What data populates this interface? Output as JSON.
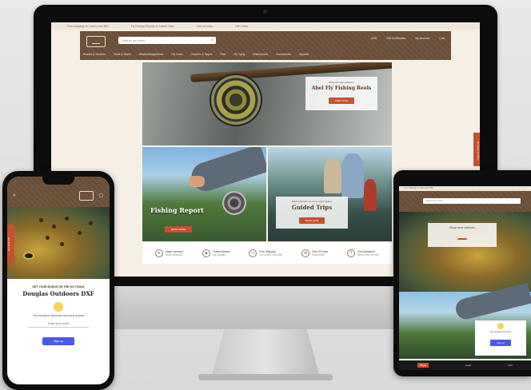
{
  "desktop": {
    "topbar": [
      "Free shipping on orders over $50",
      "Fly Fishing Reports & Guided Trips",
      "Call us today",
      "Gift Cards"
    ],
    "search_placeholder": "Search our store",
    "header_right": [
      "USD",
      "Gift Certificates",
      "My Account",
      "Cart"
    ],
    "nav": [
      "Brands & Vendors",
      "Rods & Reels",
      "Waders/Bags/Boots",
      "Fly Lines",
      "Leaders & Tippet",
      "Flies",
      "Fly Tying",
      "Waterproofs",
      "Accessories",
      "Apparel"
    ],
    "hero": {
      "subtitle": "Shop our new collection",
      "title": "Abel Fly Fishing Reels",
      "button": "SHOP NOW"
    },
    "tile_left": {
      "title": "Fishing Report",
      "button": "READ MORE"
    },
    "tile_right": {
      "subtitle": "Book a trip with one of our expert guides",
      "title": "Guided Trips",
      "button": "BOOK NOW"
    },
    "features": [
      {
        "icon": "map-icon",
        "title": "Large Inventory",
        "text": "Shop Selection"
      },
      {
        "icon": "tag-icon",
        "title": "Trusted Brands",
        "text": "Top Quality"
      },
      {
        "icon": "truck-icon",
        "title": "Free Shipping",
        "text": "On Orders Over $50"
      },
      {
        "icon": "chat-icon",
        "title": "Over 25 Years",
        "text": "Experience"
      },
      {
        "icon": "question-icon",
        "title": "Got Questions?",
        "text": "We're Here to Help"
      }
    ],
    "side_tab": "Rewards & Offers"
  },
  "phone": {
    "ribbon": "Get 10% Off",
    "modal": {
      "subtitle": "GET YOUR BONUS ON THE GO TODAY",
      "title": "Douglas Outdoors DXF",
      "text": "Get exclusive discounts and early access",
      "email_placeholder": "Enter your email",
      "button": "Sign up"
    }
  },
  "tablet": {
    "topbar": "Free shipping on orders over $50",
    "search_placeholder": "Search our store",
    "hero_title": "Shop new arrivals",
    "modal": {
      "text": "Get exclusive discounts",
      "button": "Sign up"
    },
    "bottom": [
      "SALE",
      "Login",
      "Cart"
    ]
  },
  "colors": {
    "brand_brown": "#6b4e37",
    "accent_orange": "#c4522f",
    "signup_blue": "#4a58e8"
  }
}
